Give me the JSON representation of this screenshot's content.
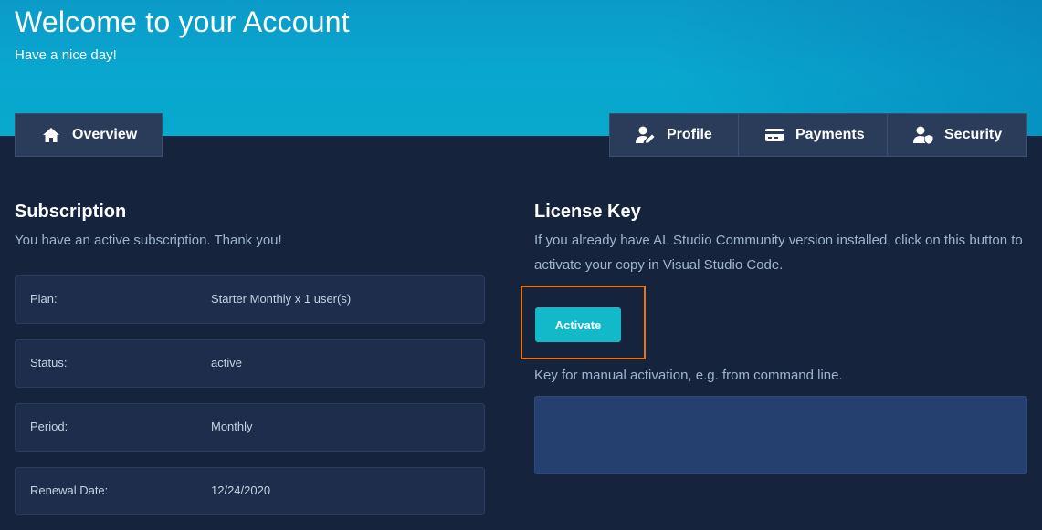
{
  "header": {
    "title": "Welcome to your Account",
    "subtitle": "Have a nice day!"
  },
  "tabs": {
    "overview": {
      "label": "Overview",
      "icon": "home-icon"
    },
    "profile": {
      "label": "Profile",
      "icon": "user-edit-icon"
    },
    "payments": {
      "label": "Payments",
      "icon": "credit-card-icon"
    },
    "security": {
      "label": "Security",
      "icon": "user-shield-icon"
    }
  },
  "subscription": {
    "title": "Subscription",
    "message": "You have an active subscription. Thank you!",
    "rows": [
      {
        "label": "Plan:",
        "value": "Starter Monthly x 1 user(s)"
      },
      {
        "label": "Status:",
        "value": "active"
      },
      {
        "label": "Period:",
        "value": "Monthly"
      },
      {
        "label": "Renewal Date:",
        "value": "12/24/2020"
      }
    ]
  },
  "license": {
    "title": "License Key",
    "description": "If you already have AL Studio Community version installed, click on this button to activate your copy in Visual Studio Code.",
    "activate_label": "Activate",
    "manual_hint": "Key for manual activation, e.g. from command line.",
    "key_value": ""
  },
  "colors": {
    "accent": "#12b9c9",
    "highlight": "#e8731a",
    "background": "#15233d"
  }
}
